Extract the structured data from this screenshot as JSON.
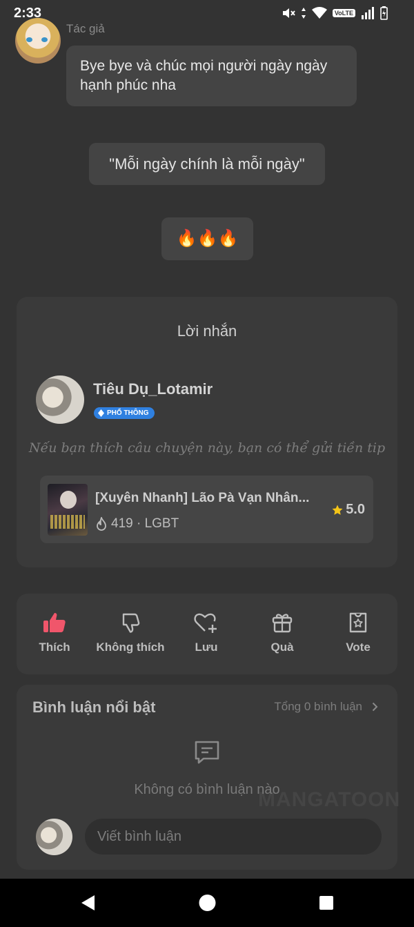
{
  "status_bar": {
    "time": "2:33",
    "network_badge": "VoLTE",
    "icons": [
      "mute-icon",
      "data-arrows-icon",
      "wifi-icon",
      "signal-icon",
      "battery-icon"
    ]
  },
  "author_message": {
    "label": "Tác giả",
    "text": "Bye bye và chúc mọi người ngày ngày hạnh phúc nha"
  },
  "quote": "\"Mỗi ngày chính là mỗi ngày\"",
  "reaction": "🔥🔥🔥",
  "note_card": {
    "title": "Lời nhắn",
    "writer_name": "Tiêu Dụ_Lotamir",
    "badge": "PHỔ THÔNG",
    "tip_text": "Nếu bạn thích câu chuyện này, bạn có thể gửi tiền tip",
    "story": {
      "title": "[Xuyên Nhanh] Lão Pà Vạn Nhân...",
      "meta": "419 · LGBT",
      "rating": "5.0"
    }
  },
  "actions": {
    "like": "Thích",
    "dislike": "Không thích",
    "save": "Lưu",
    "gift": "Quà",
    "vote": "Vote"
  },
  "comments": {
    "title": "Bình luận nổi bật",
    "total": "Tổng 0 bình luận",
    "empty": "Không có bình luận nào",
    "watermark": "MANGATOON",
    "input_placeholder": "Viết bình luận"
  },
  "colors": {
    "background": "#333333",
    "card": "#3a3a3a",
    "like_active": "#f0566b",
    "badge_blue": "#2f80e0",
    "star": "#f5c518"
  }
}
